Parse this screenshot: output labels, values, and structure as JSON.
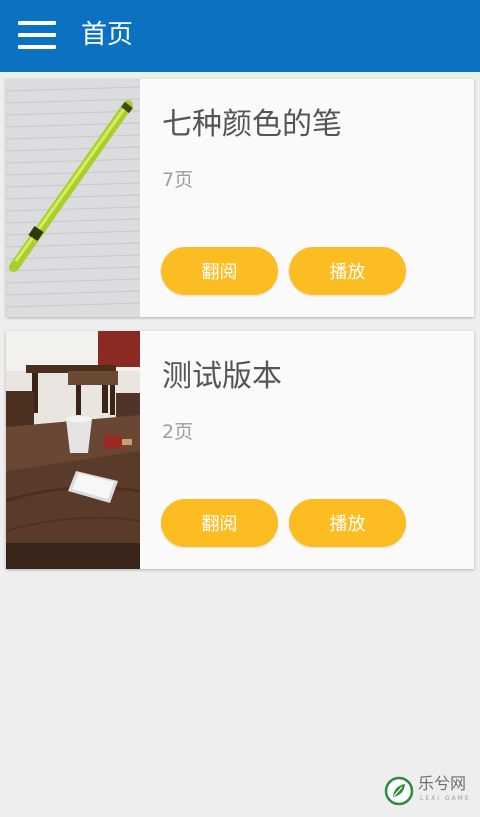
{
  "header": {
    "title": "首页",
    "menu_icon": "hamburger-menu-icon",
    "background_color": "#0a72c0"
  },
  "cards": [
    {
      "title": "七种颜色的笔",
      "pages": "7页",
      "image": "yellow-pen-photo",
      "read_label": "翻阅",
      "play_label": "播放"
    },
    {
      "title": "测试版本",
      "pages": "2页",
      "image": "table-with-phone-photo",
      "read_label": "翻阅",
      "play_label": "播放"
    }
  ],
  "button_color": "#fbbd22",
  "watermark": {
    "text": "乐兮网",
    "sub": "LEXI GAME"
  }
}
